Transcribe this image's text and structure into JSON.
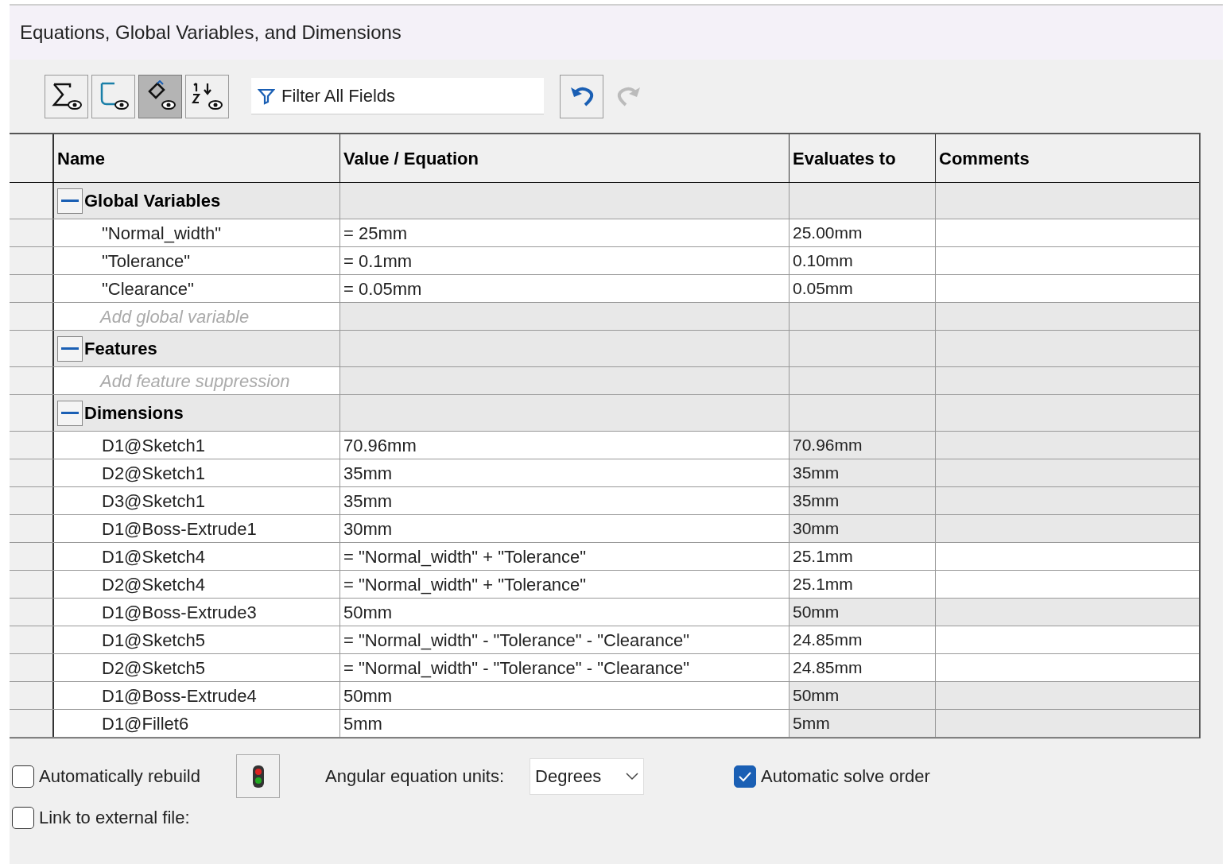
{
  "window": {
    "title": "Equations, Global Variables, and Dimensions"
  },
  "toolbar": {
    "view_buttons": [
      {
        "selected": false
      },
      {
        "selected": false
      },
      {
        "selected": true
      },
      {
        "selected": false
      }
    ],
    "filter": {
      "placeholder": "Filter All Fields"
    },
    "undo": {
      "disabled": false
    },
    "redo": {
      "disabled": true
    }
  },
  "table": {
    "columns": [
      "Name",
      "Value / Equation",
      "Evaluates to",
      "Comments"
    ],
    "sections": [
      {
        "title": "Global Variables",
        "expanded": true,
        "add_placeholder": "Add global variable",
        "rows": [
          {
            "name": "\"Normal_width\"",
            "value": "= 25mm",
            "evaluates": "25.00mm",
            "kind": "equation"
          },
          {
            "name": "\"Tolerance\"",
            "value": "= 0.1mm",
            "evaluates": "0.10mm",
            "kind": "equation"
          },
          {
            "name": "\"Clearance\"",
            "value": "= 0.05mm",
            "evaluates": "0.05mm",
            "kind": "equation"
          }
        ]
      },
      {
        "title": "Features",
        "expanded": true,
        "add_placeholder": "Add feature suppression"
      },
      {
        "title": "Dimensions",
        "expanded": true,
        "rows": [
          {
            "name": "D1@Sketch1",
            "value": "70.96mm",
            "evaluates": "70.96mm",
            "kind": "value"
          },
          {
            "name": "D2@Sketch1",
            "value": "35mm",
            "evaluates": "35mm",
            "kind": "value"
          },
          {
            "name": "D3@Sketch1",
            "value": "35mm",
            "evaluates": "35mm",
            "kind": "value"
          },
          {
            "name": "D1@Boss-Extrude1",
            "value": "30mm",
            "evaluates": "30mm",
            "kind": "value"
          },
          {
            "name": "D1@Sketch4",
            "value": "= \"Normal_width\" + \"Tolerance\"",
            "evaluates": "25.1mm",
            "kind": "equation"
          },
          {
            "name": "D2@Sketch4",
            "value": "= \"Normal_width\" + \"Tolerance\"",
            "evaluates": "25.1mm",
            "kind": "equation"
          },
          {
            "name": "D1@Boss-Extrude3",
            "value": "50mm",
            "evaluates": "50mm",
            "kind": "value"
          },
          {
            "name": "D1@Sketch5",
            "value": "= \"Normal_width\" - \"Tolerance\" - \"Clearance\"",
            "evaluates": "24.85mm",
            "kind": "equation"
          },
          {
            "name": "D2@Sketch5",
            "value": "= \"Normal_width\" - \"Tolerance\" - \"Clearance\"",
            "evaluates": "24.85mm",
            "kind": "equation"
          },
          {
            "name": "D1@Boss-Extrude4",
            "value": "50mm",
            "evaluates": "50mm",
            "kind": "value"
          },
          {
            "name": "D1@Fillet6",
            "value": "5mm",
            "evaluates": "5mm",
            "kind": "value"
          }
        ]
      }
    ]
  },
  "options": {
    "auto_rebuild": {
      "label": "Automatically rebuild",
      "checked": false
    },
    "angular_units": {
      "label": "Angular equation units:",
      "value": "Degrees"
    },
    "auto_solve": {
      "label": "Automatic solve order",
      "checked": true
    },
    "link_external": {
      "label": "Link to external file:",
      "checked": false
    }
  }
}
